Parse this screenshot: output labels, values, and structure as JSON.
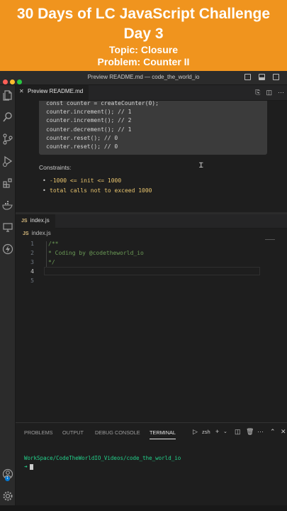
{
  "banner": {
    "line1": "30 Days of LC JavaScript Challenge",
    "line2": "Day 3",
    "topic": "Topic: Closure",
    "problem": "Problem: Counter II"
  },
  "window": {
    "title": "Preview README.md — code_the_world_io",
    "traffic_colors": [
      "#ff5f57",
      "#febc2e",
      "#28c840"
    ]
  },
  "preview_tab": {
    "label": "Preview README.md"
  },
  "preview": {
    "code_lines": [
      "const counter = createCounter(0);",
      "counter.increment(); // 1",
      "counter.increment(); // 2",
      "counter.decrement(); // 1",
      "counter.reset(); // 0",
      "counter.reset(); // 0"
    ],
    "constraints_heading": "Constraints:",
    "constraints": [
      "-1000 <= init <= 1000",
      "total calls not to exceed 1000"
    ]
  },
  "editor": {
    "tab_label": "index.js",
    "tab_badge": "JS",
    "breadcrumb": "index.js",
    "lines": [
      {
        "num": "1",
        "text": "/**"
      },
      {
        "num": "2",
        "text": " * Coding by @codetheworld_io"
      },
      {
        "num": "3",
        "text": " */"
      },
      {
        "num": "4",
        "text": ""
      },
      {
        "num": "5",
        "text": ""
      }
    ]
  },
  "panel": {
    "tabs": [
      "PROBLEMS",
      "OUTPUT",
      "DEBUG CONSOLE",
      "TERMINAL"
    ],
    "active_tab": "TERMINAL",
    "shell": "zsh",
    "terminal_path": "WorkSpace/CodeTheWorldIO_Videos/code_the_world_io",
    "prompt_symbol": "➜"
  },
  "accounts_badge": "1",
  "icons": {
    "activity": [
      "explorer-icon",
      "search-icon",
      "source-control-icon",
      "run-debug-icon",
      "extensions-icon",
      "docker-icon",
      "remote-explorer-icon",
      "thunder-client-icon"
    ],
    "bottom": [
      "account-icon",
      "settings-gear-icon"
    ]
  }
}
